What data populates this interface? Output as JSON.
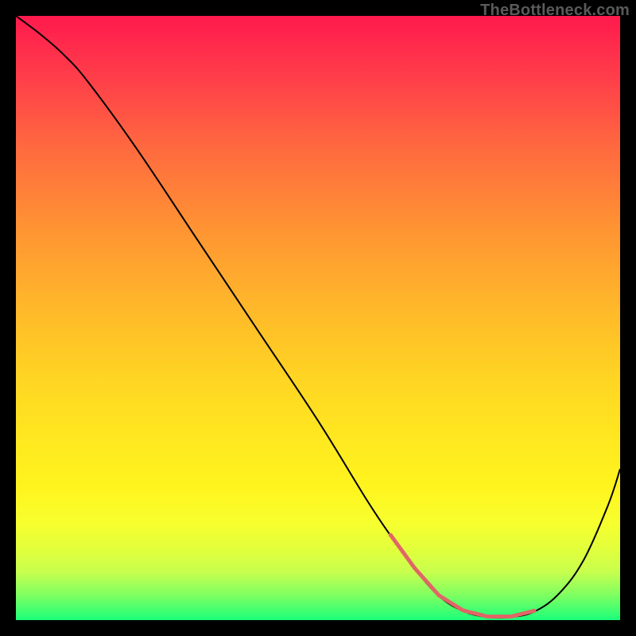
{
  "watermark": "TheBottleneck.com",
  "colors": {
    "page_bg": "#000000",
    "curve_stroke": "#000000",
    "dash_stroke": "#e06666",
    "gradient_top": "#ff1a4d",
    "gradient_bottom": "#1bff7a"
  },
  "chart_data": {
    "type": "line",
    "title": "",
    "xlabel": "",
    "ylabel": "",
    "xlim": [
      0,
      100
    ],
    "ylim": [
      0,
      100
    ],
    "grid": false,
    "legend": false,
    "series": [
      {
        "name": "bottleneck-curve",
        "x": [
          0,
          4,
          8,
          12,
          20,
          30,
          40,
          50,
          58,
          62,
          66,
          70,
          74,
          78,
          82,
          86,
          90,
          94,
          98,
          100
        ],
        "y": [
          100,
          97,
          93.5,
          89,
          78,
          63,
          48,
          33,
          20,
          14,
          8.5,
          4,
          1.5,
          0.5,
          0.5,
          1.5,
          4.5,
          10,
          19,
          25
        ]
      }
    ],
    "annotations": [
      {
        "name": "optimal-range-dashes",
        "style": "dashed",
        "color": "#e06666",
        "x_range": [
          62,
          86
        ],
        "y_approx": 0.8
      }
    ]
  }
}
